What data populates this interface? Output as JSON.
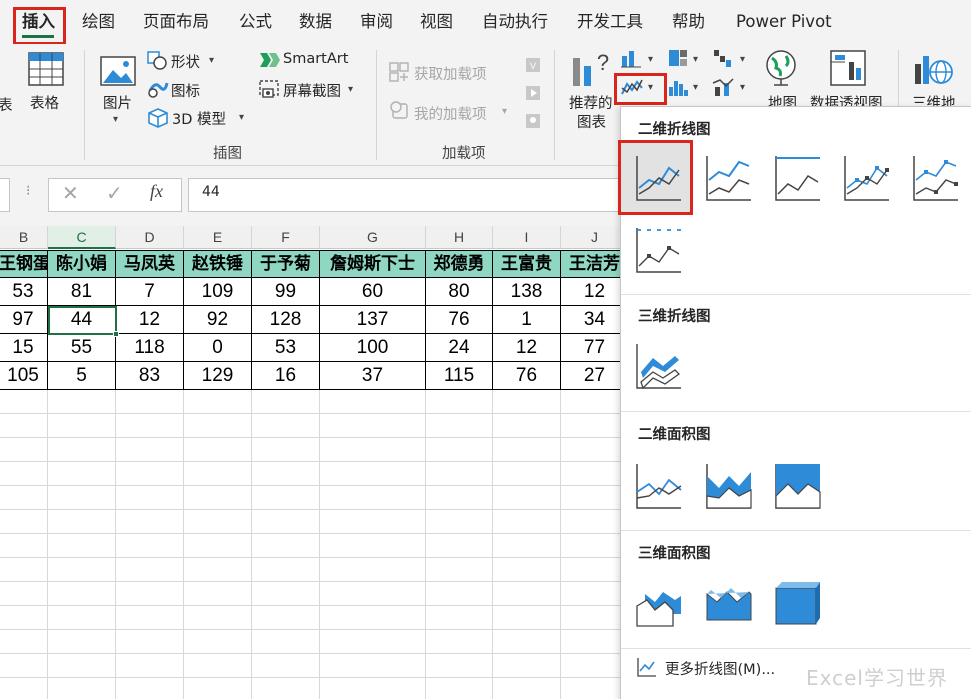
{
  "menu": {
    "tabs": [
      "插入",
      "绘图",
      "页面布局",
      "公式",
      "数据",
      "审阅",
      "视图",
      "自动执行",
      "开发工具",
      "帮助",
      "Power Pivot"
    ],
    "active_tab": "插入"
  },
  "ribbon": {
    "tables_group": {
      "biao": "表",
      "table_label": "表格"
    },
    "illustrations": {
      "pictures_label": "图片",
      "shapes_label": "形状",
      "icons_label": "图标",
      "model3d_label": "3D 模型",
      "smartart_label": "SmartArt",
      "screenshot_label": "屏幕截图",
      "group_label": "插图"
    },
    "addins": {
      "get_addins_label": "获取加载项",
      "my_addins_label": "我的加载项",
      "group_label": "加载项"
    },
    "charts": {
      "recommended_line1": "推荐的",
      "recommended_line2": "图表",
      "map_label": "地图",
      "pivot_chart_label": "数据透视图",
      "three_d_label": "三维地"
    }
  },
  "formula_bar": {
    "value": "44"
  },
  "sheet": {
    "columns": [
      "B",
      "C",
      "D",
      "E",
      "F",
      "G",
      "H",
      "I",
      "J"
    ],
    "selected_column": "C",
    "headers": [
      "王钢蛋",
      "陈小娟",
      "马凤英",
      "赵铁锤",
      "于予菊",
      "詹姆斯下士",
      "郑德勇",
      "王富贵",
      "王洁芳"
    ],
    "rows": [
      [
        "53",
        "81",
        "7",
        "109",
        "99",
        "60",
        "80",
        "138",
        "12"
      ],
      [
        "97",
        "44",
        "12",
        "92",
        "128",
        "137",
        "76",
        "1",
        "34"
      ],
      [
        "15",
        "55",
        "118",
        "0",
        "53",
        "100",
        "24",
        "12",
        "77"
      ],
      [
        "105",
        "5",
        "83",
        "129",
        "16",
        "37",
        "115",
        "76",
        "27"
      ]
    ]
  },
  "dropdown": {
    "section_2d_line": "二维折线图",
    "section_3d_line": "三维折线图",
    "section_2d_area": "二维面积图",
    "section_3d_area": "三维面积图",
    "more_lines": "更多折线图(M)..."
  },
  "watermark": "Excel学习世界",
  "colors": {
    "accent_green": "#1e7145",
    "highlight_red": "#d9251c",
    "header_fill": "#8fd7c2",
    "chart_blue": "#2e8bd8"
  }
}
